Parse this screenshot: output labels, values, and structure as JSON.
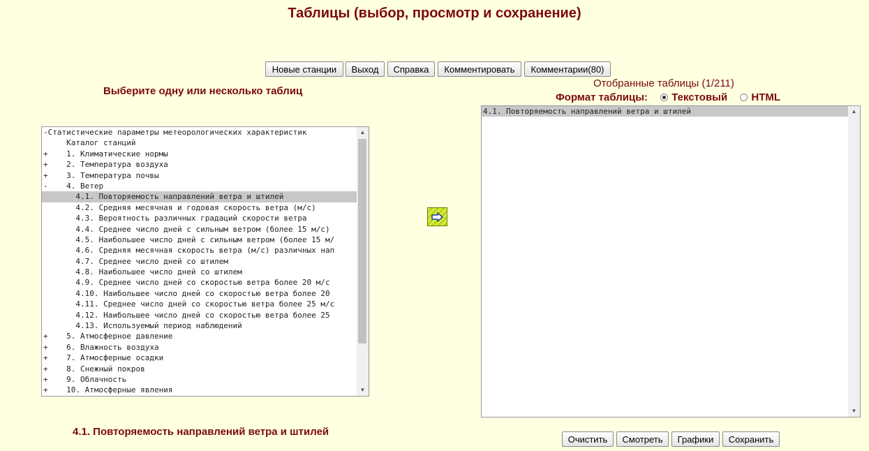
{
  "page_title": "Таблицы (выбор, просмотр и сохранение)",
  "toolbar": {
    "new_stations": "Новые станции",
    "exit": "Выход",
    "help": "Справка",
    "comment": "Комментировать",
    "comments": "Комментарии(80)"
  },
  "left_heading": "Выберите одну или несколько таблиц",
  "right": {
    "selected_label": "Отобранные таблицы (1/211)",
    "format_label": "Формат таблицы:",
    "format_options": [
      "Текстовый",
      "HTML"
    ],
    "format_selected": "Текстовый"
  },
  "tree": {
    "items": [
      {
        "marker": "-",
        "text": "Статистические параметры метеорологических характеристик",
        "indent": 0
      },
      {
        "marker": "",
        "text": "Каталог станций",
        "indent": 1
      },
      {
        "marker": "+",
        "text": "1. Климатические нормы",
        "indent": 1
      },
      {
        "marker": "+",
        "text": "2. Температура воздуха",
        "indent": 1
      },
      {
        "marker": "+",
        "text": "3. Температура почвы",
        "indent": 1
      },
      {
        "marker": "-",
        "text": "4. Ветер",
        "indent": 1
      },
      {
        "marker": "",
        "text": "4.1. Повторяемость направлений ветра и штилей",
        "indent": 2,
        "selected": true
      },
      {
        "marker": "",
        "text": "4.2. Средняя месячная и годовая скорость ветра (м/с)",
        "indent": 2
      },
      {
        "marker": "",
        "text": "4.3. Вероятность различных градаций скорости ветра",
        "indent": 2
      },
      {
        "marker": "",
        "text": "4.4. Среднее число дней с сильным ветром (более 15 м/с)",
        "indent": 2
      },
      {
        "marker": "",
        "text": "4.5. Наибольшее число дней с сильным ветром (более 15 м/",
        "indent": 2
      },
      {
        "marker": "",
        "text": "4.6. Средняя месячная скорость ветра (м/с) различных нап",
        "indent": 2
      },
      {
        "marker": "",
        "text": "4.7. Среднее число дней со штилем",
        "indent": 2
      },
      {
        "marker": "",
        "text": "4.8. Наибольшее число дней со штилем",
        "indent": 2
      },
      {
        "marker": "",
        "text": "4.9. Среднее число дней со скоростью ветра более 20 м/с",
        "indent": 2
      },
      {
        "marker": "",
        "text": "4.10. Наибольшее число дней со скоростью ветра более 20",
        "indent": 2
      },
      {
        "marker": "",
        "text": "4.11. Среднее число дней со скоростью ветра более 25 м/с",
        "indent": 2
      },
      {
        "marker": "",
        "text": "4.12. Наибольшее число дней со скоростью ветра более 25",
        "indent": 2
      },
      {
        "marker": "",
        "text": "4.13. Используемый период наблюдений",
        "indent": 2
      },
      {
        "marker": "+",
        "text": "5. Атмосферное давление",
        "indent": 1
      },
      {
        "marker": "+",
        "text": "6. Влажность воздуха",
        "indent": 1
      },
      {
        "marker": "+",
        "text": "7. Атмосферные осадки",
        "indent": 1
      },
      {
        "marker": "+",
        "text": "8. Снежный покров",
        "indent": 1
      },
      {
        "marker": "+",
        "text": "9. Облачность",
        "indent": 1
      },
      {
        "marker": "+",
        "text": "10. Атмосферные явления",
        "indent": 1
      }
    ]
  },
  "selected_tables": [
    "4.1. Повторяемость направлений ветра и штилей"
  ],
  "add_button_icon": "arrow-right-icon",
  "bottom_buttons": {
    "clear": "Очистить",
    "view": "Смотреть",
    "charts": "Графики",
    "save": "Сохранить"
  },
  "current_table_title": "4.1. Повторяемость направлений ветра и штилей"
}
